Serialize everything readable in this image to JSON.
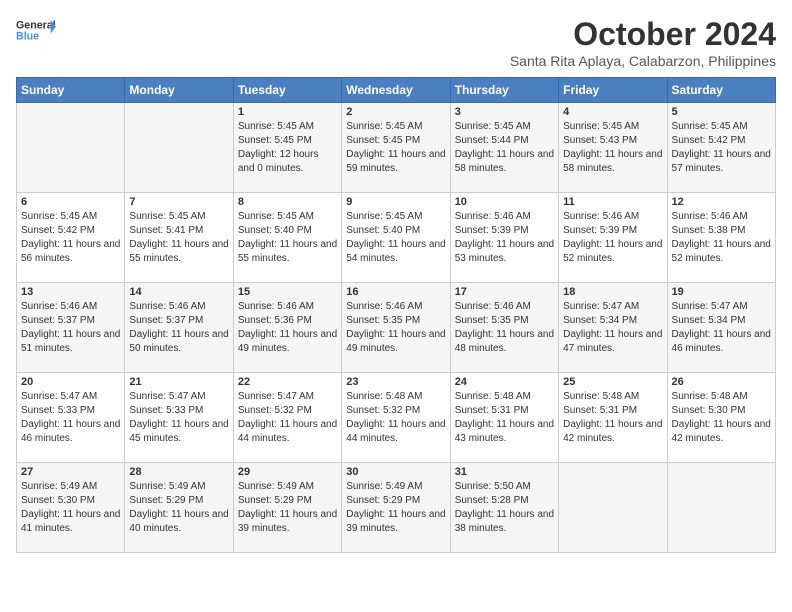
{
  "header": {
    "logo_line1": "General",
    "logo_line2": "Blue",
    "month": "October 2024",
    "location": "Santa Rita Aplaya, Calabarzon, Philippines"
  },
  "days_of_week": [
    "Sunday",
    "Monday",
    "Tuesday",
    "Wednesday",
    "Thursday",
    "Friday",
    "Saturday"
  ],
  "weeks": [
    [
      {
        "day": "",
        "info": ""
      },
      {
        "day": "",
        "info": ""
      },
      {
        "day": "1",
        "info": "Sunrise: 5:45 AM\nSunset: 5:45 PM\nDaylight: 12 hours and 0 minutes."
      },
      {
        "day": "2",
        "info": "Sunrise: 5:45 AM\nSunset: 5:45 PM\nDaylight: 11 hours and 59 minutes."
      },
      {
        "day": "3",
        "info": "Sunrise: 5:45 AM\nSunset: 5:44 PM\nDaylight: 11 hours and 58 minutes."
      },
      {
        "day": "4",
        "info": "Sunrise: 5:45 AM\nSunset: 5:43 PM\nDaylight: 11 hours and 58 minutes."
      },
      {
        "day": "5",
        "info": "Sunrise: 5:45 AM\nSunset: 5:42 PM\nDaylight: 11 hours and 57 minutes."
      }
    ],
    [
      {
        "day": "6",
        "info": "Sunrise: 5:45 AM\nSunset: 5:42 PM\nDaylight: 11 hours and 56 minutes."
      },
      {
        "day": "7",
        "info": "Sunrise: 5:45 AM\nSunset: 5:41 PM\nDaylight: 11 hours and 55 minutes."
      },
      {
        "day": "8",
        "info": "Sunrise: 5:45 AM\nSunset: 5:40 PM\nDaylight: 11 hours and 55 minutes."
      },
      {
        "day": "9",
        "info": "Sunrise: 5:45 AM\nSunset: 5:40 PM\nDaylight: 11 hours and 54 minutes."
      },
      {
        "day": "10",
        "info": "Sunrise: 5:46 AM\nSunset: 5:39 PM\nDaylight: 11 hours and 53 minutes."
      },
      {
        "day": "11",
        "info": "Sunrise: 5:46 AM\nSunset: 5:39 PM\nDaylight: 11 hours and 52 minutes."
      },
      {
        "day": "12",
        "info": "Sunrise: 5:46 AM\nSunset: 5:38 PM\nDaylight: 11 hours and 52 minutes."
      }
    ],
    [
      {
        "day": "13",
        "info": "Sunrise: 5:46 AM\nSunset: 5:37 PM\nDaylight: 11 hours and 51 minutes."
      },
      {
        "day": "14",
        "info": "Sunrise: 5:46 AM\nSunset: 5:37 PM\nDaylight: 11 hours and 50 minutes."
      },
      {
        "day": "15",
        "info": "Sunrise: 5:46 AM\nSunset: 5:36 PM\nDaylight: 11 hours and 49 minutes."
      },
      {
        "day": "16",
        "info": "Sunrise: 5:46 AM\nSunset: 5:35 PM\nDaylight: 11 hours and 49 minutes."
      },
      {
        "day": "17",
        "info": "Sunrise: 5:46 AM\nSunset: 5:35 PM\nDaylight: 11 hours and 48 minutes."
      },
      {
        "day": "18",
        "info": "Sunrise: 5:47 AM\nSunset: 5:34 PM\nDaylight: 11 hours and 47 minutes."
      },
      {
        "day": "19",
        "info": "Sunrise: 5:47 AM\nSunset: 5:34 PM\nDaylight: 11 hours and 46 minutes."
      }
    ],
    [
      {
        "day": "20",
        "info": "Sunrise: 5:47 AM\nSunset: 5:33 PM\nDaylight: 11 hours and 46 minutes."
      },
      {
        "day": "21",
        "info": "Sunrise: 5:47 AM\nSunset: 5:33 PM\nDaylight: 11 hours and 45 minutes."
      },
      {
        "day": "22",
        "info": "Sunrise: 5:47 AM\nSunset: 5:32 PM\nDaylight: 11 hours and 44 minutes."
      },
      {
        "day": "23",
        "info": "Sunrise: 5:48 AM\nSunset: 5:32 PM\nDaylight: 11 hours and 44 minutes."
      },
      {
        "day": "24",
        "info": "Sunrise: 5:48 AM\nSunset: 5:31 PM\nDaylight: 11 hours and 43 minutes."
      },
      {
        "day": "25",
        "info": "Sunrise: 5:48 AM\nSunset: 5:31 PM\nDaylight: 11 hours and 42 minutes."
      },
      {
        "day": "26",
        "info": "Sunrise: 5:48 AM\nSunset: 5:30 PM\nDaylight: 11 hours and 42 minutes."
      }
    ],
    [
      {
        "day": "27",
        "info": "Sunrise: 5:49 AM\nSunset: 5:30 PM\nDaylight: 11 hours and 41 minutes."
      },
      {
        "day": "28",
        "info": "Sunrise: 5:49 AM\nSunset: 5:29 PM\nDaylight: 11 hours and 40 minutes."
      },
      {
        "day": "29",
        "info": "Sunrise: 5:49 AM\nSunset: 5:29 PM\nDaylight: 11 hours and 39 minutes."
      },
      {
        "day": "30",
        "info": "Sunrise: 5:49 AM\nSunset: 5:29 PM\nDaylight: 11 hours and 39 minutes."
      },
      {
        "day": "31",
        "info": "Sunrise: 5:50 AM\nSunset: 5:28 PM\nDaylight: 11 hours and 38 minutes."
      },
      {
        "day": "",
        "info": ""
      },
      {
        "day": "",
        "info": ""
      }
    ]
  ]
}
